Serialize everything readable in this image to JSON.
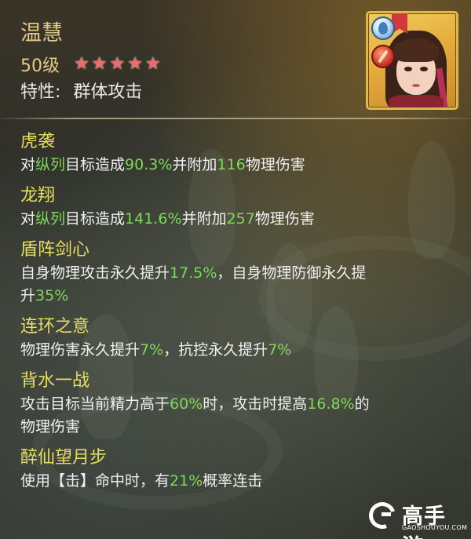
{
  "hero": {
    "name": "温慧",
    "level": "50级",
    "stars": 5,
    "trait_label": "特性:",
    "trait_value": "群体攻击",
    "star_color": "#f06a6a"
  },
  "portrait": {
    "element_icon": "water-drop-icon",
    "weapon_icon": "weapon-icon"
  },
  "skills": [
    {
      "name": "虎袭",
      "desc": [
        {
          "t": "对"
        },
        {
          "t": "纵列",
          "hl": true
        },
        {
          "t": "目标造成"
        },
        {
          "t": "90.3%",
          "hl": true
        },
        {
          "t": "并附加"
        },
        {
          "t": "116",
          "hl": true
        },
        {
          "t": "物理伤害"
        }
      ]
    },
    {
      "name": "龙翔",
      "desc": [
        {
          "t": "对"
        },
        {
          "t": "纵列",
          "hl": true
        },
        {
          "t": "目标造成"
        },
        {
          "t": "141.6%",
          "hl": true
        },
        {
          "t": "并附加"
        },
        {
          "t": "257",
          "hl": true
        },
        {
          "t": "物理伤害"
        }
      ]
    },
    {
      "name": "盾阵剑心",
      "desc": [
        {
          "t": "自身物理攻击永久提升"
        },
        {
          "t": "17.5%",
          "hl": true
        },
        {
          "t": "，自身物理防御永久提"
        },
        {
          "br": true
        },
        {
          "t": "升"
        },
        {
          "t": "35%",
          "hl": true
        }
      ]
    },
    {
      "name": "连环之意",
      "desc": [
        {
          "t": "物理伤害永久提升"
        },
        {
          "t": "7%",
          "hl": true
        },
        {
          "t": "，抗控永久提升"
        },
        {
          "t": "7%",
          "hl": true
        }
      ]
    },
    {
      "name": "背水一战",
      "desc": [
        {
          "t": "攻击目标当前精力高于"
        },
        {
          "t": "60%",
          "hl": true
        },
        {
          "t": "时，攻击时提高"
        },
        {
          "t": "16.8%",
          "hl": true
        },
        {
          "t": "的"
        },
        {
          "br": true
        },
        {
          "t": "物理伤害"
        }
      ]
    },
    {
      "name": "醉仙望月步",
      "desc": [
        {
          "t": "使用【击】命中时，有"
        },
        {
          "t": "21%",
          "hl": true
        },
        {
          "t": "概率连击"
        }
      ]
    }
  ],
  "watermark": {
    "name": "高手游",
    "site": "GAOSHOUYOU.COM"
  },
  "colors": {
    "name": "#e2c987",
    "skill_name": "#e8de5e",
    "highlight": "#7ed85a",
    "text": "#f0f0f0",
    "portrait_frame": "#e0b84a"
  }
}
